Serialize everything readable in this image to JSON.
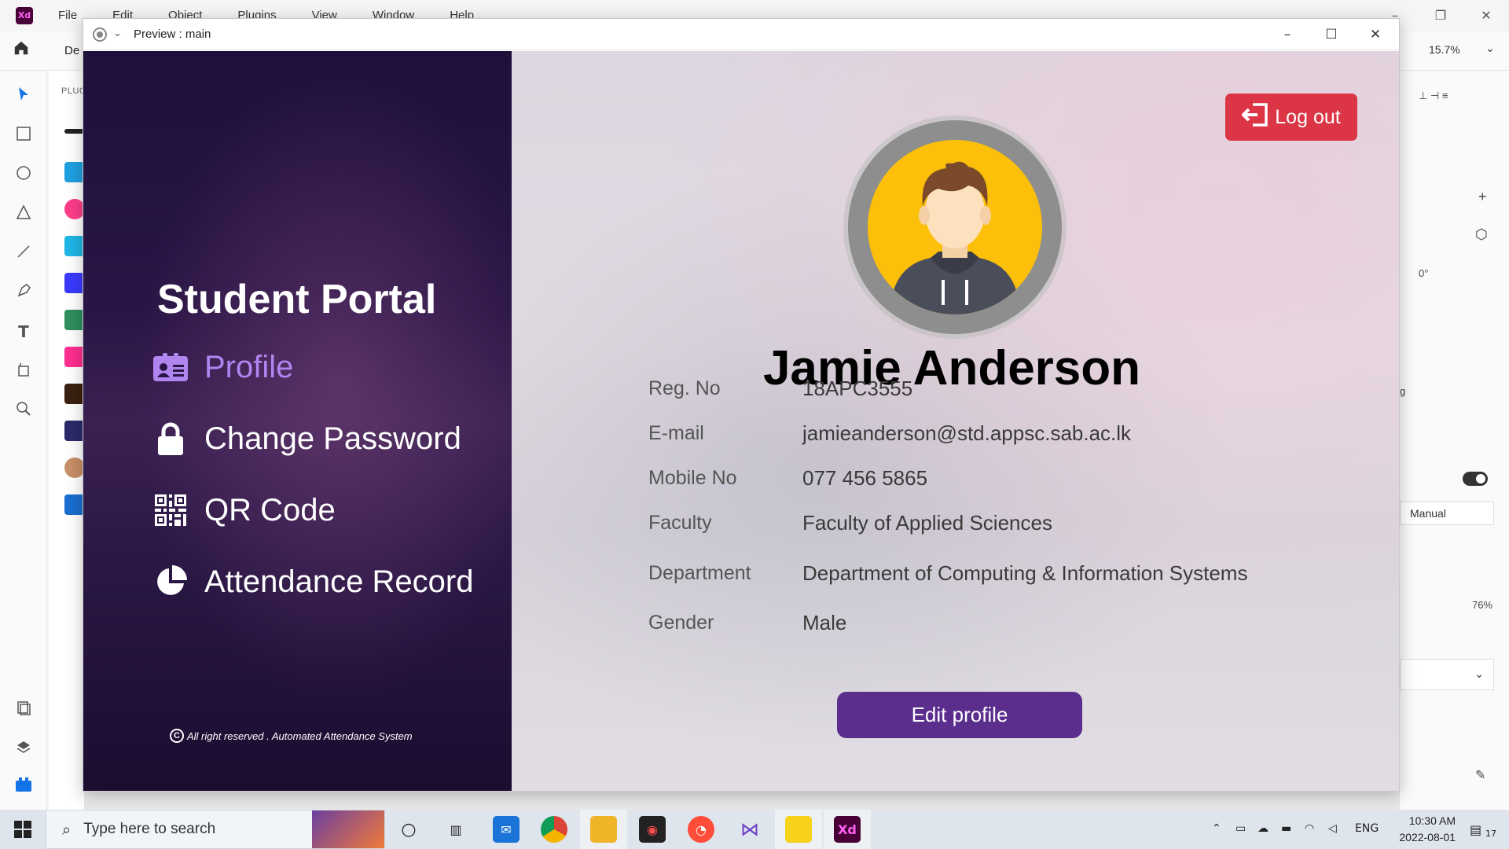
{
  "xd": {
    "logo": "Xd",
    "menu": [
      "File",
      "Edit",
      "Object",
      "Plugins",
      "View",
      "Window",
      "Help"
    ],
    "tab": "De",
    "zoom": "15.7%",
    "plugins_label": "PLUG",
    "right_panel": {
      "rotation": "0°",
      "letter": "g",
      "select_value": "Manual",
      "percent": "76%"
    }
  },
  "preview": {
    "title": "Preview : main"
  },
  "app": {
    "brand": "Student Portal",
    "nav": [
      {
        "label": "Profile",
        "icon": "id-card-icon",
        "active": true
      },
      {
        "label": "Change Password",
        "icon": "lock-icon",
        "active": false
      },
      {
        "label": "QR Code",
        "icon": "qr-code-icon",
        "active": false
      },
      {
        "label": "Attendance Record",
        "icon": "pie-chart-icon",
        "active": false
      }
    ],
    "copyright_symbol": "C",
    "copyright": "All right reserved . Automated Attendance System",
    "logout_label": "Log out",
    "profile": {
      "name": "Jamie Anderson",
      "fields": [
        {
          "label": "Reg. No",
          "value": "18APC3555"
        },
        {
          "label": "E-mail",
          "value": "jamieanderson@std.appsc.sab.ac.lk"
        },
        {
          "label": "Mobile No",
          "value": "077 456 5865"
        },
        {
          "label": "Faculty",
          "value": "Faculty of Applied Sciences"
        },
        {
          "label": "Department",
          "value": "Department of Computing & Information Systems"
        },
        {
          "label": "Gender",
          "value": "Male"
        }
      ],
      "edit_label": "Edit profile"
    }
  },
  "taskbar": {
    "search_placeholder": "Type here to search",
    "tray_lang": "ENG",
    "time": "10:30 AM",
    "date": "2022-08-01",
    "notification_count": "17"
  },
  "colors": {
    "logout": "#dc3545",
    "edit": "#5b2d8c",
    "active_nav": "#b085f0",
    "avatar_bg": "#fdc00a"
  }
}
